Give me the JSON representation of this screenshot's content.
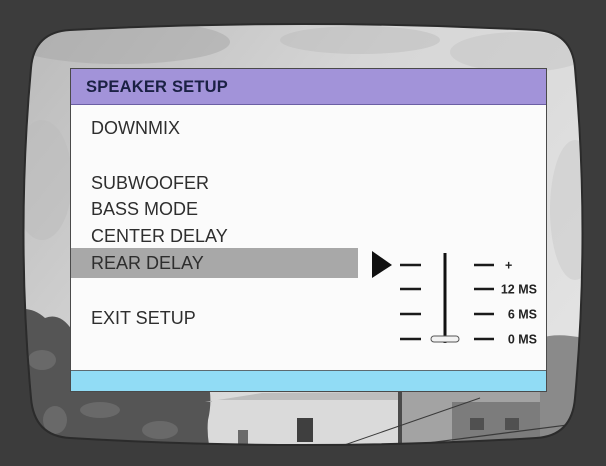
{
  "menu": {
    "title": "SPEAKER SETUP",
    "items": [
      {
        "label": "DOWNMIX",
        "selected": false
      },
      {
        "label": "SUBWOOFER",
        "selected": false
      },
      {
        "label": "BASS MODE",
        "selected": false
      },
      {
        "label": "CENTER DELAY",
        "selected": false
      },
      {
        "label": "REAR DELAY",
        "selected": true
      },
      {
        "label": "EXIT SETUP",
        "selected": false
      }
    ]
  },
  "rear_delay_slider": {
    "scale_labels": [
      "+",
      "12 MS",
      "6 MS",
      "0 MS"
    ],
    "value_ms": 0
  },
  "icons": {
    "selection_pointer": "triangle-right-icon"
  },
  "colors": {
    "header": "#a293d9",
    "header_text": "#1b2144",
    "selected_row": "#a8a8a8",
    "footer_bar": "#91dcf5",
    "frame": "#3c3c3c"
  }
}
